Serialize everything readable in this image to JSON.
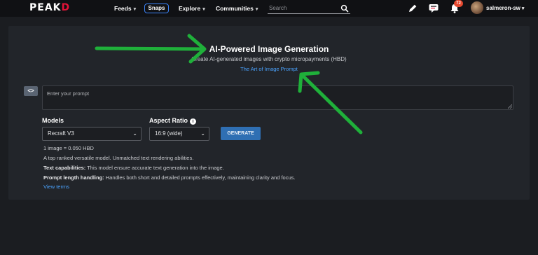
{
  "nav": {
    "logo_main": "PEAK",
    "logo_accent": "D",
    "items": [
      {
        "label": "Feeds",
        "chevron": "▾"
      },
      {
        "label": "Snaps"
      },
      {
        "label": "Explore",
        "chevron": "▾"
      },
      {
        "label": "Communities",
        "chevron": "▾"
      }
    ],
    "search_placeholder": "Search",
    "notification_count": "72",
    "username": "salmeron-sw",
    "user_chevron": "▾",
    "icons": [
      "search-icon",
      "pencil-icon",
      "chat-icon",
      "bell-icon",
      "avatar"
    ]
  },
  "page": {
    "title": "AI-Powered Image Generation",
    "subtitle": "Create AI-generated images with crypto micropayments (HBD)",
    "art_link": "The Art of Image Prompt",
    "code_button": "<>",
    "prompt_placeholder": "Enter your prompt",
    "models_label": "Models",
    "model_selected": "Recraft V3",
    "aspect_label": "Aspect Ratio",
    "aspect_info": "i",
    "aspect_selected": "16:9 (wide)",
    "select_chevron": "⌄",
    "generate_label": "GENERATE",
    "price": "1 image = 0.050 HBD",
    "description": "A top ranked versatile model. Unmatched text rendering abilities.",
    "text_cap_label": "Text capabilities:",
    "text_cap_value": " This model ensure accurate text generation into the image.",
    "prompt_len_label": "Prompt length handling:",
    "prompt_len_value": " Handles both short and detailed prompts effectively, maintaining clarity and focus.",
    "terms_link": "View terms"
  },
  "colors": {
    "background": "#1b1d21",
    "topbar": "#101114",
    "card": "#22252a",
    "brand_red": "#e31337",
    "link_blue": "#4aa3ff",
    "button_blue": "#2f6fb3",
    "badge": "#e8492f",
    "annotation_arrow": "#1fb03a"
  }
}
